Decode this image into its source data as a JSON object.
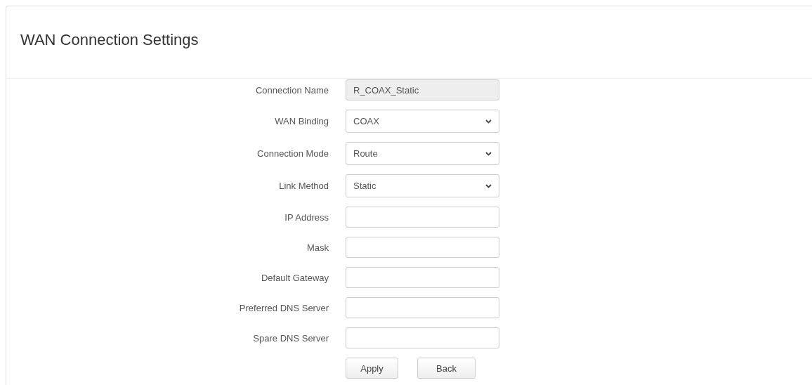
{
  "panel": {
    "title": "WAN Connection Settings"
  },
  "fields": [
    {
      "label": "Connection Name",
      "kind": "text",
      "value": "R_COAX_Static",
      "disabled": true
    },
    {
      "label": "WAN Binding",
      "kind": "select",
      "value": "COAX",
      "disabled": false
    },
    {
      "label": "Connection Mode",
      "kind": "select",
      "value": "Route",
      "disabled": false
    },
    {
      "label": "Link Method",
      "kind": "select",
      "value": "Static",
      "disabled": false
    },
    {
      "label": "IP Address",
      "kind": "text",
      "disabled": false
    },
    {
      "label": "Mask",
      "kind": "text",
      "disabled": false
    },
    {
      "label": "Default Gateway",
      "kind": "text",
      "disabled": false
    },
    {
      "label": "Preferred DNS Server",
      "kind": "text",
      "disabled": false
    },
    {
      "label": "Spare DNS Server",
      "kind": "text",
      "disabled": false
    }
  ],
  "buttons": [
    "Apply",
    "Back"
  ]
}
